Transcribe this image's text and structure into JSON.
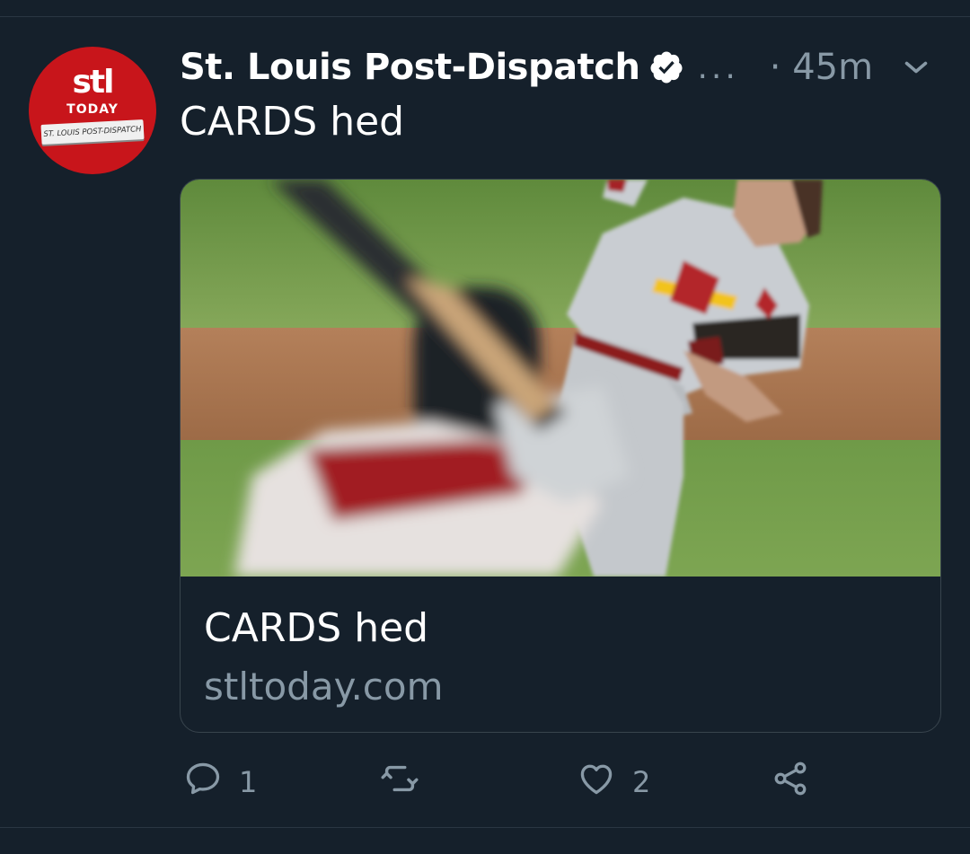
{
  "tweet": {
    "author": {
      "display_name": "St. Louis Post-Dispatch",
      "verified": true,
      "avatar": {
        "brand_text": "stl",
        "brand_subtext": "TODAY",
        "paper_text": "ST. LOUIS POST-DISPATCH",
        "color": "#c8151b"
      }
    },
    "more_menu_label": "...",
    "timestamp": "· 45m",
    "text": "CARDS hed",
    "card": {
      "image_icon": "baseball-pitcher-photo",
      "title": "CARDS hed",
      "domain": "stltoday.com"
    },
    "actions": {
      "reply_count": "1",
      "retweet_count": "",
      "like_count": "2"
    }
  },
  "colors": {
    "background": "#15202b",
    "text_primary": "#ffffff",
    "text_secondary": "#8899a6",
    "border": "#38444d"
  }
}
